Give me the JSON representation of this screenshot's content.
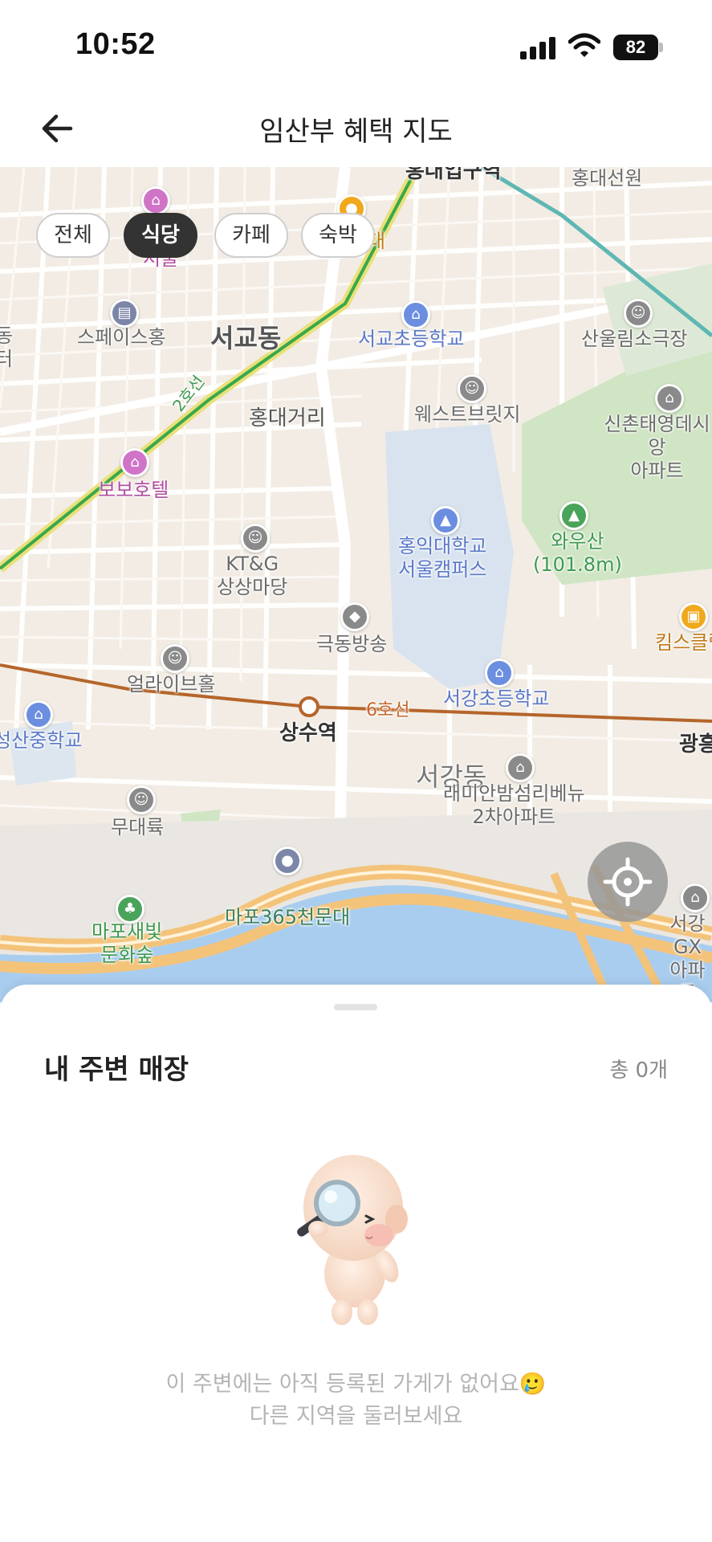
{
  "status_bar": {
    "time": "10:52",
    "battery": "82"
  },
  "header": {
    "title": "임산부 혜택 지도"
  },
  "filters": [
    {
      "label": "전체",
      "active": false
    },
    {
      "label": "식당",
      "active": true
    },
    {
      "label": "카페",
      "active": false
    },
    {
      "label": "숙박",
      "active": false
    }
  ],
  "map": {
    "labels": {
      "hongdae_station": "홍대입구역",
      "hongdae_seonwon": "홍대선원",
      "space_hong": "스페이스홍",
      "seogyo_dong": "서교동",
      "seogyo_elem": "서교초등학교",
      "sanul_theater": "산울림소극장",
      "line2": "2호선",
      "hongdae_street": "홍대거리",
      "west_bridge": "웨스트브릿지",
      "sinchon_apt": "신촌태영데시앙\n아파트",
      "bobo_hotel": "보보호텔",
      "hongik_univ": "홍익대학교\n서울캠퍼스",
      "wausan": "와우산\n(101.8m)",
      "ktg": "KT&G\n상상마당",
      "kids": "킴스클럽",
      "geukdong": "극동방송",
      "alive_hall": "얼라이브홀",
      "seogang_elem": "서강초등학교",
      "sangsu_station": "상수역",
      "line6": "6호선",
      "gwangheung": "광흥창역",
      "seongsan_mid": "성산중학교",
      "seogang_dong": "서강동",
      "raemian": "래미안밤섬리베뉴\n2차아파트",
      "mudaeryuk": "무대륙",
      "mapo365": "마포365천문대",
      "mapo_saebit": "마포새빛\n문화숲",
      "seogang_gx": "서강GX\n아파트",
      "left_edge_1": "동\n터",
      "hotel_seoul": "서울",
      "hongdae_short": "대"
    }
  },
  "sheet": {
    "title": "내 주변 매장",
    "count": "총 0개",
    "empty_line1": "이 주변에는 아직 등록된 가게가 없어요🥲",
    "empty_line2": "다른 지역을 둘러보세요"
  },
  "colors": {
    "chip_active_bg": "#333333",
    "line2": "#3aa84a",
    "line6": "#b5652a",
    "river": "#a9cdee",
    "park": "#cfe5c3"
  }
}
